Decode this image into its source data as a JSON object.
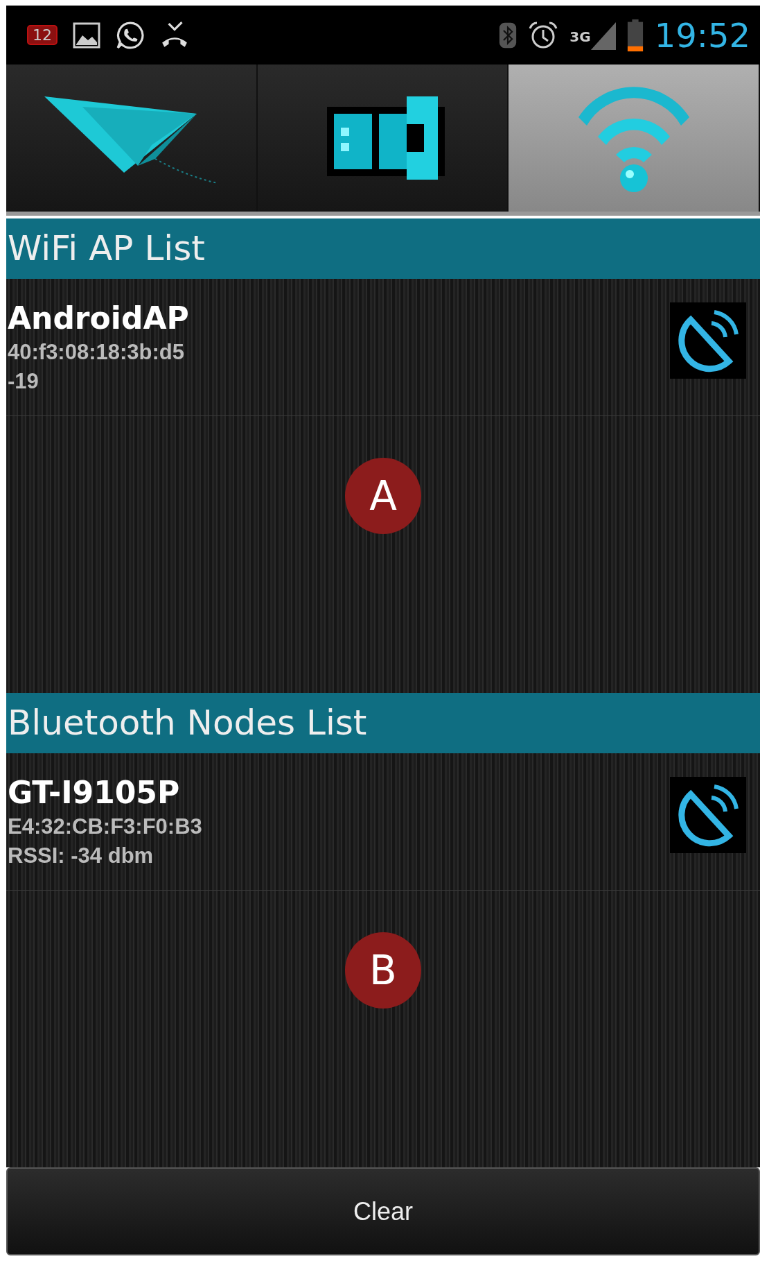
{
  "status_bar": {
    "notification_count": "12",
    "network": "3G",
    "time": "19:52"
  },
  "tabs": [
    {
      "kind": "plane",
      "selected": false
    },
    {
      "kind": "robot",
      "selected": false
    },
    {
      "kind": "wifi",
      "selected": true
    }
  ],
  "sections": [
    {
      "title": "WiFi AP List",
      "items": [
        {
          "name": "AndroidAP",
          "address": "40:f3:08:18:3b:d5",
          "signal": "-19"
        }
      ],
      "marker": "A"
    },
    {
      "title": "Bluetooth Nodes List",
      "items": [
        {
          "name": "GT-I9105P",
          "address": "E4:32:CB:F3:F0:B3",
          "signal": "RSSI: -34 dbm"
        }
      ],
      "marker": "B"
    }
  ],
  "button": "Clear"
}
